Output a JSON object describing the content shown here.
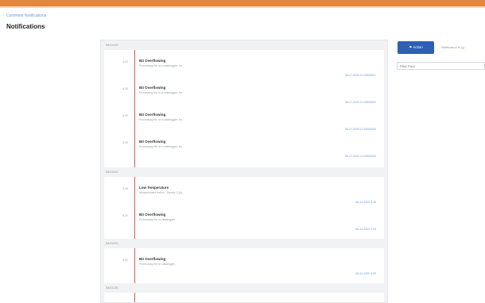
{
  "header": {
    "breadcrumb": "Comment Notifications",
    "title": "Notifications"
  },
  "sidebar": {
    "action_label": "Action",
    "link_label": "Notification in (g",
    "filter_placeholder": "Filter Field"
  },
  "groups": [
    {
      "label": "08/14/20",
      "items": [
        {
          "time": "4:20",
          "title": "Bit Overflowing",
          "subtitle": "Processing file on a datalogger, thr...",
          "date": "08-17-2020 11:20000001"
        },
        {
          "time": "4:20",
          "title": "Bit Overflowing",
          "subtitle": "Processing file on a datalogger, thr...",
          "date": "08-17-2020 11:20000002"
        },
        {
          "time": "4:20",
          "title": "Bit Overflowing",
          "subtitle": "Processing file on a datalogger, thr...",
          "date": "08-17-2020 11:20000003"
        },
        {
          "time": "4:20",
          "title": "Bit Overflowing",
          "subtitle": "Processing file on a datalogger, thr...",
          "date": "08-17-2020 11:20000004"
        }
      ]
    },
    {
      "label": "08/13/20",
      "items": [
        {
          "time": "3:15",
          "title": "Low Temperature",
          "subtitle": "Measurement below - Sensor 3 (A)",
          "date": "08-13-2020 3:15"
        },
        {
          "time": "4:20",
          "title": "Bit Overflowing",
          "subtitle": "Processing file on datalogger",
          "date": "08-13-2020 4:20"
        }
      ]
    },
    {
      "label": "08/12/20",
      "items": [
        {
          "time": "4:20",
          "title": "Bit Overflowing",
          "subtitle": "Processing file on datalogger",
          "date": "08-12-2020 4:20"
        }
      ]
    },
    {
      "label": "08/11/20",
      "items": []
    }
  ]
}
